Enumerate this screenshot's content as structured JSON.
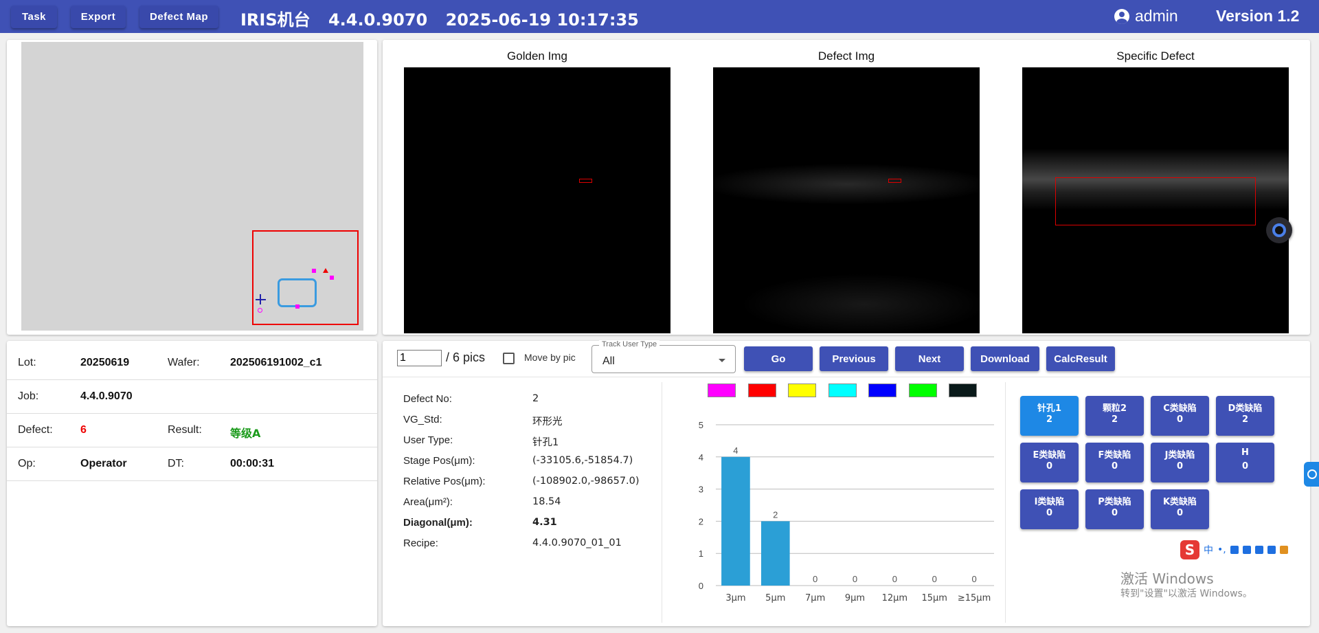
{
  "header": {
    "buttons": [
      "Task",
      "Export",
      "Defect Map"
    ],
    "machine": "IRIS机台",
    "version_num": "4.4.0.9070",
    "datetime": "2025-06-19 10:17:35",
    "user": "admin",
    "app_version": "Version 1.2",
    "user_icon": "account-circle-icon"
  },
  "images": {
    "golden_label": "Golden Img",
    "defect_label": "Defect Img",
    "specific_label": "Specific Defect"
  },
  "info": {
    "lot_label": "Lot:",
    "lot": "20250619",
    "wafer_label": "Wafer:",
    "wafer": "202506191002_c1",
    "job_label": "Job:",
    "job": "4.4.0.9070",
    "defect_label": "Defect:",
    "defect": "6",
    "result_label": "Result:",
    "result": "等级A",
    "op_label": "Op:",
    "op": "Operator",
    "dt_label": "DT:",
    "dt": "00:00:31"
  },
  "controls": {
    "page": "1",
    "total": "/ 6 pics",
    "move_by_pic": "Move by pic",
    "track_legend": "Track User Type",
    "track_value": "All",
    "go": "Go",
    "previous": "Previous",
    "next": "Next",
    "download": "Download",
    "calc": "CalcResult"
  },
  "details": [
    {
      "label": "Defect No:",
      "value": "2",
      "bold": false
    },
    {
      "label": "VG_Std:",
      "value": "环形光",
      "bold": false
    },
    {
      "label": "User Type:",
      "value": "针孔1",
      "bold": false
    },
    {
      "label": "Stage Pos(μm):",
      "value": "(-33105.6,-51854.7)",
      "bold": false
    },
    {
      "label": "Relative Pos(μm):",
      "value": "(-108902.0,-98657.0)",
      "bold": false
    },
    {
      "label": "Area(μm²):",
      "value": "18.54",
      "bold": false
    },
    {
      "label": "Diagonal(μm):",
      "value": "4.31",
      "bold": true
    },
    {
      "label": "Recipe:",
      "value": "4.4.0.9070_01_01",
      "bold": false
    }
  ],
  "swatch_colors": [
    "#ff00ff",
    "#ff0000",
    "#ffff00",
    "#00ffff",
    "#0000ff",
    "#00ff00",
    "#0a1a1a"
  ],
  "chart_data": {
    "type": "bar",
    "categories": [
      "3μm",
      "5μm",
      "7μm",
      "9μm",
      "12μm",
      "15μm",
      "≥15μm"
    ],
    "values": [
      4,
      2,
      0,
      0,
      0,
      0,
      0
    ],
    "ylim": [
      0,
      5
    ],
    "yticks": [
      "0",
      "1",
      "2",
      "3",
      "4",
      "5"
    ],
    "grid": true,
    "bar_color": "#2b9fd6"
  },
  "classes": [
    {
      "name": "针孔1",
      "count": "2",
      "active": true
    },
    {
      "name": "颗粒2",
      "count": "2",
      "active": false
    },
    {
      "name": "C类缺陷",
      "count": "0",
      "active": false
    },
    {
      "name": "D类缺陷",
      "count": "2",
      "active": false
    },
    {
      "name": "E类缺陷",
      "count": "0",
      "active": false
    },
    {
      "name": "F类缺陷",
      "count": "0",
      "active": false
    },
    {
      "name": "J类缺陷",
      "count": "0",
      "active": false
    },
    {
      "name": "H",
      "count": "0",
      "active": false
    },
    {
      "name": "I类缺陷",
      "count": "0",
      "active": false
    },
    {
      "name": "P类缺陷",
      "count": "0",
      "active": false
    },
    {
      "name": "K类缺陷",
      "count": "0",
      "active": false
    }
  ],
  "system": {
    "ime_logo": "S",
    "ime_mode": "中",
    "ime_punct": "•,",
    "win_title": "激活 Windows",
    "win_sub": "转到\"设置\"以激活 Windows。"
  }
}
